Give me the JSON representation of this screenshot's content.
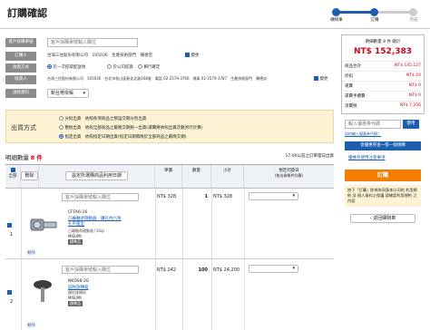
{
  "header": {
    "title": "訂購確認",
    "steps": [
      "購物車",
      "訂購",
      "完成"
    ]
  },
  "form": {
    "order_no_label": "客戶採購單號",
    "order_no_placeholder": "客戶採購單號輸入欄位",
    "orderer_label": "訂購人",
    "orderer_info": "台灣三住股份有限公司　105036　生產技術部門　陳德忠",
    "orderer_change": "變更",
    "delivery_label": "收貨方式",
    "delivery_options": [
      "於一次提取配送地",
      "於公司提貨",
      "郵行確定"
    ],
    "receiver_label": "收貨人",
    "receiver_info": "台灣三住股份有限公司　105036　台北市松山區敦化北路168號　電話 02-2579-3766　傳真 02-2579-3787　生產技術部門　陳德忠",
    "receiver_change": "變更",
    "payment_label": "請款資料",
    "payment_value": "新台幣依帳"
  },
  "shipping": {
    "label": "出貨方式",
    "options": [
      "分批出貨　依照各項商品之預設交期分別出貨",
      "整批出貨　依照全部商品之最晚交期統一出貨(運費將依照出貨次數另行計算)",
      "指定出貨　依照指定日期出貨(指定日期需晚於全部商品之最晚交期)"
    ],
    "selected_index": 2
  },
  "items_header": {
    "title": "明細數量",
    "count": "8 件",
    "delete": "刪除",
    "note": "17:00以前之訂單當日出貨"
  },
  "table_headers": {
    "all": "全部",
    "bulk_button": "設定所選購商品利用日期",
    "unit_price": "單價",
    "qty": "數量",
    "subtotal": "小計",
    "ship_date": "預定到貨日",
    "ship_date_sub": "(依出貨條件計算)"
  },
  "items": [
    {
      "no": "1",
      "remark_placeholder": "客戶採購單號輸入欄位",
      "part_no": "CFFA6-16",
      "name": "凸輪軸承隨動器　鑽孔內六角孔平面型",
      "spec": "凸輪軸承隨動器 (16φ)",
      "brand": "MISUMI",
      "tag": "標準品",
      "unit_price": "NT$ 328",
      "qty": "1",
      "subtotal": "NT$ 328",
      "delete": "刪除"
    },
    {
      "no": "2",
      "remark_placeholder": "客戶採購單號輸入欄位",
      "part_no": "NKDS6-20",
      "name": "圓柱旋轉鈕",
      "spec": "圓柱旋轉鈕",
      "brand": "MISUMI",
      "tag": "標準品",
      "unit_price": "NT$ 242",
      "qty": "100",
      "subtotal": "NT$ 24,200",
      "delete": "刪除"
    }
  ],
  "summary": {
    "total_label": "明細數量 8 件 總計",
    "total_value": "NT$ 152,383",
    "rows": [
      {
        "label": "商品合計",
        "value": "NT$ 145,127"
      },
      {
        "label": "折扣",
        "value": "NT$ 24"
      },
      {
        "label": "運費",
        "value": "NT$ 0"
      },
      {
        "label": "運費手續費",
        "value": "NT$ 0"
      },
      {
        "label": "消費稅",
        "value": "NT$ 7,256"
      }
    ],
    "coupon_placeholder": "輸入優惠券代碼",
    "coupon_apply": "使用",
    "coupon_link": "如何輸入優惠券代碼？",
    "quote_button": "從優惠券查一張一個請購",
    "quote_link": "優惠券使用注意事項",
    "order_button": "訂購",
    "terms": "按下「訂購」即視為同意本公司的 利用規約 及 個人資料之保護 請確認利用規約 之 內容",
    "back_button": "返回購物車"
  }
}
